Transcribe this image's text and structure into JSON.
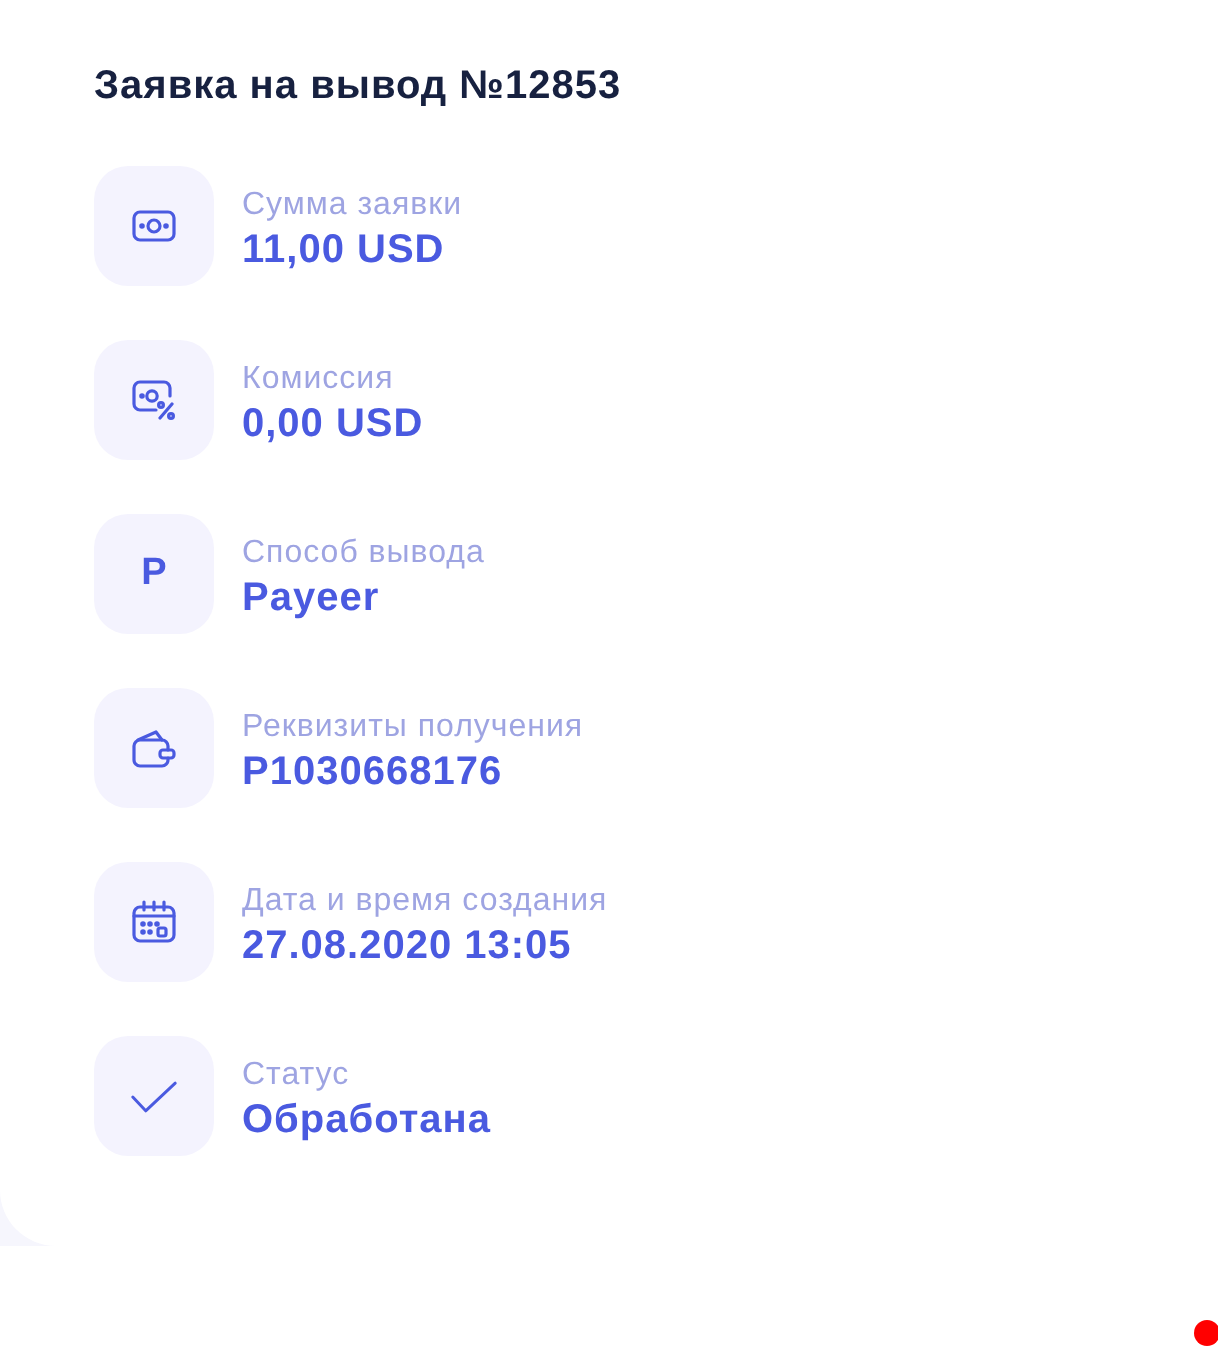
{
  "title": "Заявка на вывод №12853",
  "details": [
    {
      "kind": "money",
      "label": "Сумма заявки",
      "value": "11,00 USD"
    },
    {
      "kind": "commission",
      "label": "Комиссия",
      "value": "0,00 USD"
    },
    {
      "kind": "letter",
      "icon_text": "P",
      "label": "Способ вывода",
      "value": "Payeer"
    },
    {
      "kind": "wallet",
      "label": "Реквизиты получения",
      "value": "P1030668176"
    },
    {
      "kind": "calendar",
      "label": "Дата и время создания",
      "value": "27.08.2020 13:05"
    },
    {
      "kind": "check",
      "label": "Статус",
      "value": "Обработана"
    }
  ]
}
